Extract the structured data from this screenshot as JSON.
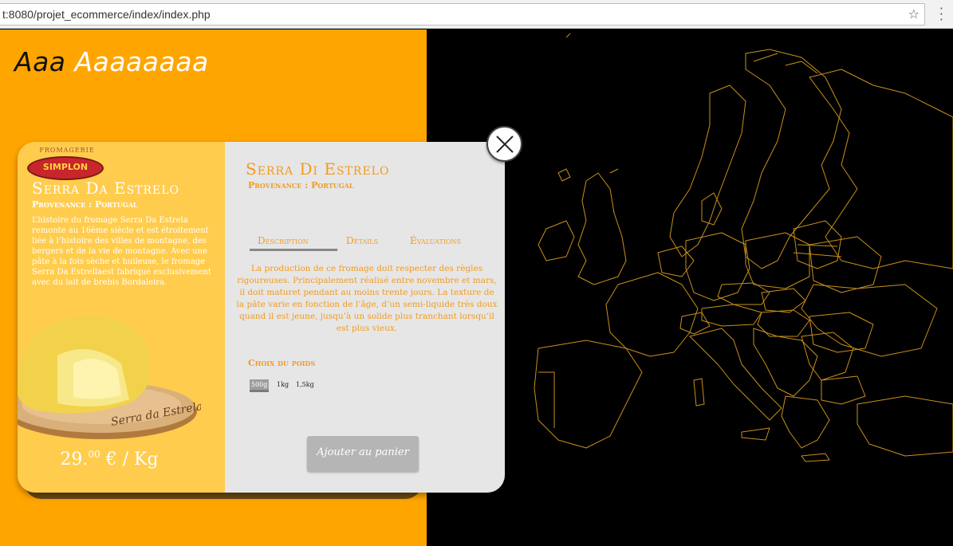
{
  "browser": {
    "url": "t:8080/projet_ecommerce/index/index.php",
    "star_icon": "star-icon",
    "menu_icon": "kebab-menu-icon"
  },
  "site": {
    "title_dark": "Aaa",
    "title_light": "Aaaaaaaa"
  },
  "card": {
    "logo_top": "FROMAGERIE",
    "logo_brand": "SIMPLON",
    "title": "Serra Da Estrelo",
    "provenance": "Provenance : Portugal",
    "description": "L’histoire du fromage Serra Da Estrela remonte au 16ème siècle et est étroitement liée à l’histoire des villes de montagne, des bergers et de la vie de montagne. Avec une pâte à la fois sèche et huileuse, le fromage Serra Da Estrellaest fabriqué exclusivement avec du lait de brebis Bordaleira.",
    "cheese_label": "Serra da Estrela",
    "price_int": "29.",
    "price_dec": "00",
    "price_unit": " € / Kg"
  },
  "detail": {
    "title": "Serra Di Estrelo",
    "provenance": "Provenance : Portugal",
    "tabs": [
      "Description",
      "Détails",
      "Évaluations"
    ],
    "active_tab": "Description",
    "text": "La production de ce fromage doit respecter des règles rigoureuses. Principalement  réalisé entre novembre et mars, il doit maturet pendant au moins trente jours. La texture de la pâte varie en fonction de l’âge, d’un semi-liquide très doux quand il est jeune, jusqu’à un solide plus tranchant lorsqu’il est plus vieux.",
    "weight_title": "Choix du poids",
    "weights": [
      "500g",
      "1kg",
      "1,5kg"
    ],
    "selected_weight": "500g",
    "cart_button": "Ajouter au panier"
  },
  "modal": {
    "close_icon": "close-icon"
  },
  "colors": {
    "orange": "#ffa500",
    "card_yellow": "#ffcc4d",
    "accent": "#f29b1f",
    "map_border": "#c8901a"
  }
}
